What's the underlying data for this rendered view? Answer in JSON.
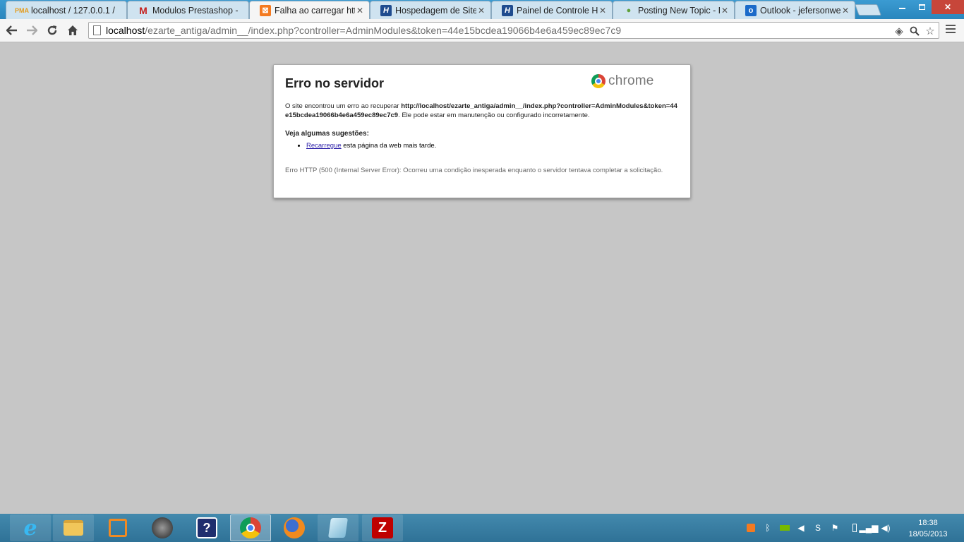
{
  "browser": {
    "tabs": [
      {
        "title": "localhost / 127.0.0.1 / ",
        "favicon": "phpmyadmin-icon"
      },
      {
        "title": "Modulos Prestashop - ",
        "favicon": "gmail-icon"
      },
      {
        "title": "Falha ao carregar http:",
        "favicon": "xampp-icon",
        "active": true
      },
      {
        "title": "Hospedagem de Sites",
        "favicon": "hostgator-icon"
      },
      {
        "title": "Painel de Controle Ho",
        "favicon": "hostgator-icon"
      },
      {
        "title": "Posting New Topic - P",
        "favicon": "forum-icon"
      },
      {
        "title": "Outlook - jefersonweb",
        "favicon": "outlook-icon"
      }
    ],
    "close_glyph": "✕",
    "url_host": "localhost",
    "url_path": "/ezarte_antiga/admin__/index.php?controller=AdminModules&token=44e15bcdea19066b4e6a459ec89ec7c9"
  },
  "error_page": {
    "title": "Erro no servidor",
    "brand": "chrome",
    "message_prefix": "O site encontrou um erro ao recuperar ",
    "message_url": "http://localhost/ezarte_antiga/admin__/index.php?controller=AdminModules&token=44e15bcdea19066b4e6a459ec89ec7c9",
    "message_suffix": ". Ele pode estar em manutenção ou configurado incorretamente.",
    "suggestions_heading": "Veja algumas sugestões:",
    "suggestion_link": "Recarregue",
    "suggestion_text": " esta página da web mais tarde.",
    "detail": "Erro HTTP (500 (Internal Server Error): Ocorreu uma condição inesperada enquanto o servidor tentava completar a solicitação."
  },
  "taskbar": {
    "apps": [
      {
        "name": "internet-explorer-icon"
      },
      {
        "name": "file-explorer-icon"
      },
      {
        "name": "office-icon"
      },
      {
        "name": "media-player-icon"
      },
      {
        "name": "help-icon"
      },
      {
        "name": "chrome-icon",
        "active": true
      },
      {
        "name": "firefox-icon"
      },
      {
        "name": "notepad-icon"
      },
      {
        "name": "filezilla-icon"
      }
    ],
    "time": "18:38",
    "date": "18/05/2013"
  },
  "colors": {
    "taskbar": "#3a7ea3",
    "tabstrip": "#2d8fc4",
    "page_background": "#c6c6c6",
    "link": "#2b1fa8"
  }
}
